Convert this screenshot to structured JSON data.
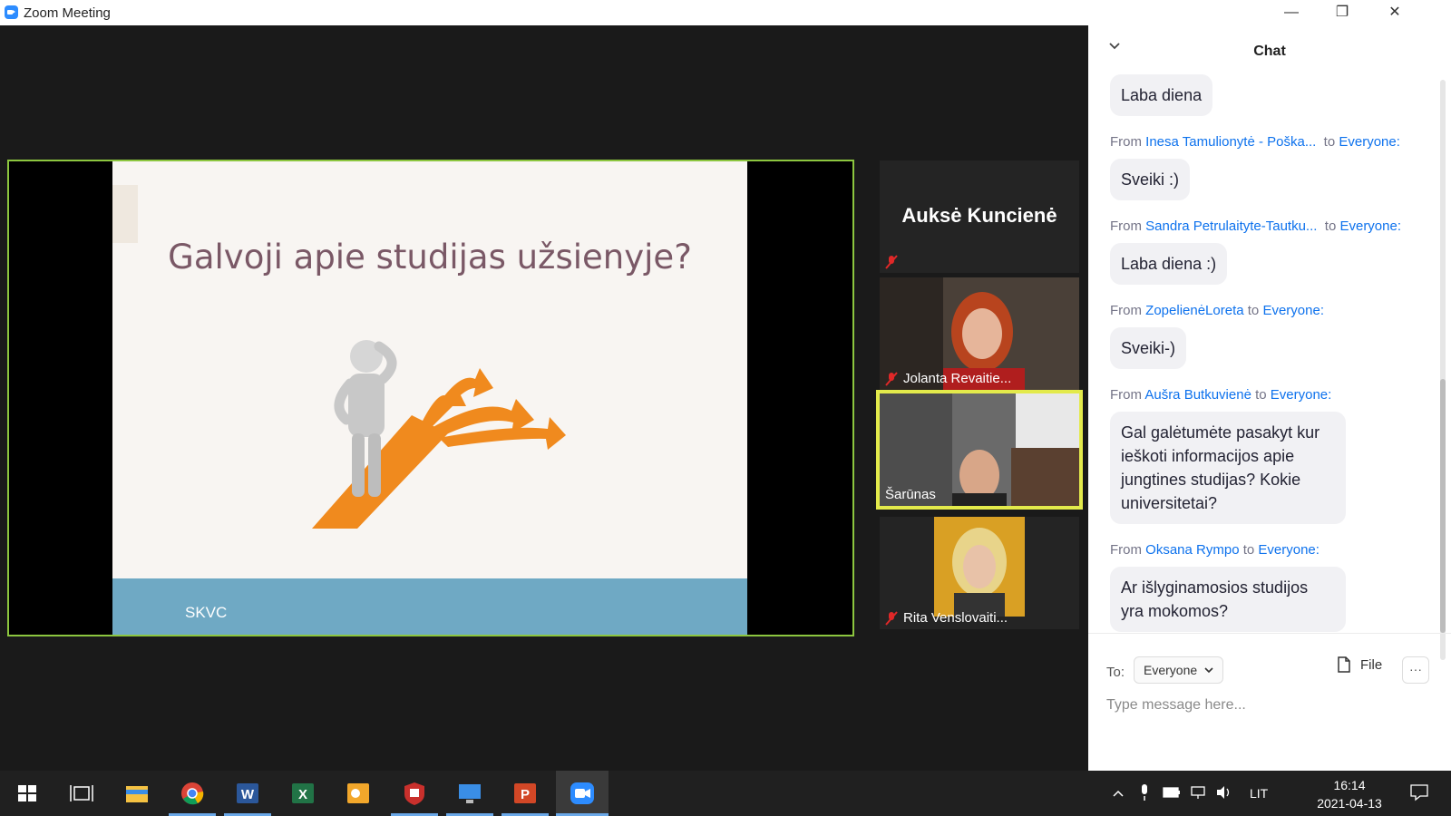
{
  "window": {
    "title": "Zoom Meeting",
    "minimize": "—",
    "restore": "❐",
    "close": "✕"
  },
  "slide": {
    "title": "Galvoji apie studijas užsienyje?",
    "logo": "SKVC"
  },
  "participants": [
    {
      "name": "Auksė Kuncienė",
      "muted": true,
      "video": false
    },
    {
      "name": "Jolanta Revaitie...",
      "muted": true,
      "video": true
    },
    {
      "name": "Šarūnas",
      "muted": false,
      "video": true,
      "active": true
    },
    {
      "name": "Rita Venslovaiti...",
      "muted": true,
      "video": true
    }
  ],
  "chat": {
    "title": "Chat",
    "from_label": "From",
    "to_label": "to",
    "messages": [
      {
        "text": "Laba diena"
      },
      {
        "sender": "Inesa Tamulionytė - Poška...",
        "recipient": "Everyone:",
        "text": "Sveiki :)"
      },
      {
        "sender": "Sandra Petrulaityte-Tautku...",
        "recipient": "Everyone:",
        "text": "Laba diena :)"
      },
      {
        "sender": "ZopelienėLoreta",
        "recipient": "Everyone:",
        "text": "Sveiki-)"
      },
      {
        "sender": "Aušra Butkuvienė",
        "recipient": "Everyone:",
        "text": "Gal galėtumėte pasakyt kur ieškoti informacijos apie jungtines studijas? Kokie universitetai?"
      },
      {
        "sender": "Oksana Rympo",
        "recipient": "Everyone:",
        "text": "Ar išlyginamosios studijos yra mokomos?"
      }
    ],
    "to_prefix": "To:",
    "to_value": "Everyone",
    "file_label": "File",
    "more_label": "···",
    "input_placeholder": "Type message here..."
  },
  "taskbar": {
    "apps": [
      "windows-start",
      "task-view",
      "file-explorer",
      "chrome",
      "word",
      "excel",
      "outlook",
      "shield-app",
      "remote-desktop",
      "powerpoint",
      "zoom"
    ],
    "language": "LIT",
    "time": "16:14",
    "date": "2021-04-13"
  },
  "colors": {
    "accent": "#0e72ed",
    "active_speaker": "#e3ea4b",
    "share_border": "#8cc63f",
    "taskbar": "#202020"
  }
}
